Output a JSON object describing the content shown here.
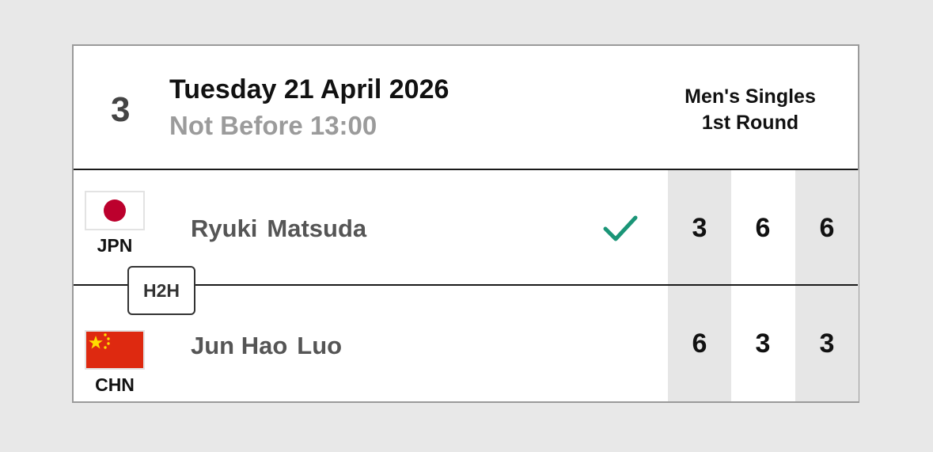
{
  "match": {
    "court": "3",
    "date": "Tuesday 21 April 2026",
    "time": "Not Before 13:00",
    "event_line1": "Men's Singles",
    "event_line2": "1st Round"
  },
  "players": [
    {
      "country": "JPN",
      "first_name": "Ryuki",
      "last_name": "Matsuda",
      "winner": true,
      "scores": [
        "3",
        "6",
        "6"
      ],
      "flag_icon": "japan-flag-icon"
    },
    {
      "country": "CHN",
      "first_name": "Jun Hao",
      "last_name": "Luo",
      "winner": false,
      "scores": [
        "6",
        "3",
        "3"
      ],
      "flag_icon": "china-flag-icon"
    }
  ],
  "h2h_label": "H2H",
  "colors": {
    "winner_check": "#1a9577",
    "score_shade": "#e6e6e6",
    "japan_red": "#bc002d",
    "china_red": "#de2910",
    "china_star": "#ffde00"
  }
}
